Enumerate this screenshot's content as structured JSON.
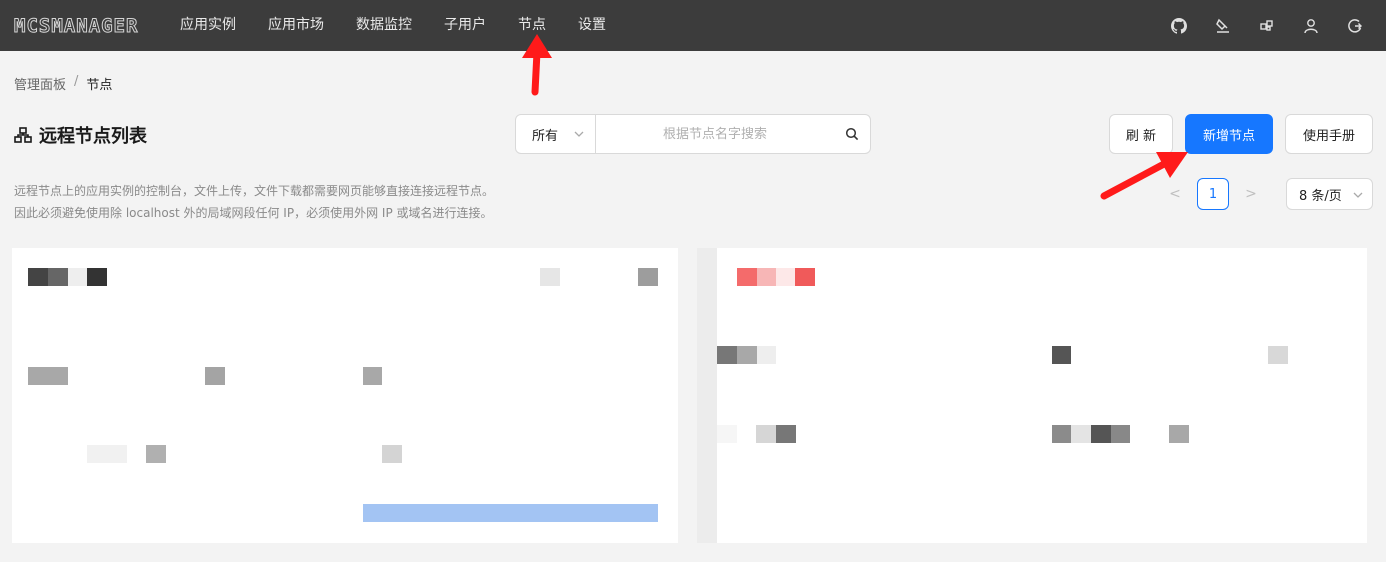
{
  "app": {
    "logo": "MCSMANAGER"
  },
  "nav": [
    "应用实例",
    "应用市场",
    "数据监控",
    "子用户",
    "节点",
    "设置"
  ],
  "top_icons": [
    "github-icon",
    "theme-icon",
    "extension-icon",
    "user-icon",
    "logout-icon"
  ],
  "breadcrumb": {
    "root": "管理面板",
    "separator": "/",
    "current": "节点"
  },
  "page": {
    "title": "远程节点列表"
  },
  "filter": {
    "selected": "所有"
  },
  "search": {
    "placeholder": "根据节点名字搜索",
    "value": ""
  },
  "buttons": {
    "refresh": "刷 新",
    "add_node": "新增节点",
    "manual": "使用手册"
  },
  "notice": {
    "line1": "远程节点上的应用实例的控制台，文件上传，文件下载都需要网页能够直接连接远程节点。",
    "line2": "因此必须避免使用除 localhost 外的局域网段任何 IP，必须使用外网 IP 或域名进行连接。"
  },
  "pagination": {
    "prev": "<",
    "current": "1",
    "next": ">",
    "page_size": "8 条/页"
  },
  "colors": {
    "topbar": "#3c3c3c",
    "primary": "#1677ff",
    "annotation_arrow": "#ff1a1a",
    "progress_fill": "#a3c4f3"
  }
}
